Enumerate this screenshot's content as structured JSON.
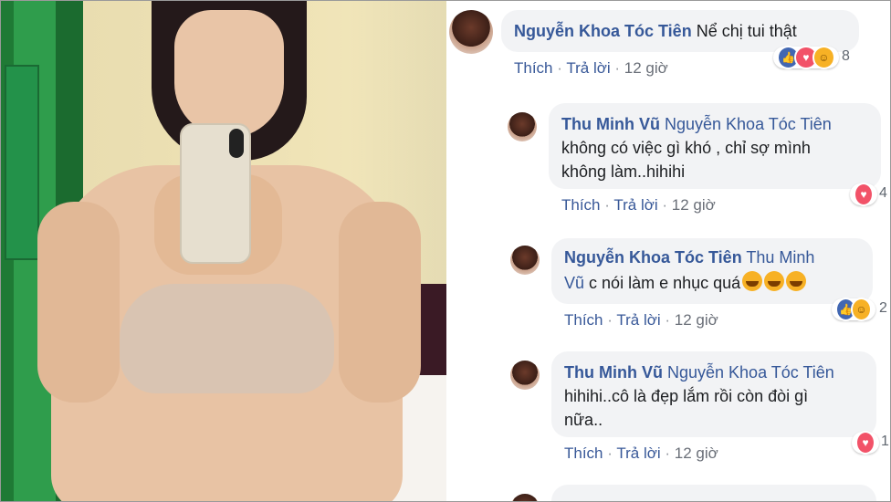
{
  "comments": [
    {
      "author": "Nguyễn Khoa Tóc Tiên",
      "text": "Nể chị tui thật",
      "actions": {
        "like": "Thích",
        "reply": "Trả lời",
        "time": "12 giờ"
      },
      "reactions": {
        "icons": [
          "like-icon",
          "love-icon",
          "haha-icon"
        ],
        "count": "8"
      }
    },
    {
      "author": "Thu Minh Vũ",
      "mention": "Nguyễn Khoa Tóc Tiên",
      "text_line1": "không có việc gì khó , chỉ sợ mình",
      "text_line2": "không làm..hihihi",
      "actions": {
        "like": "Thích",
        "reply": "Trả lời",
        "time": "12 giờ"
      },
      "reactions": {
        "icons": [
          "love-icon"
        ],
        "count": "4"
      }
    },
    {
      "author": "Nguyễn Khoa Tóc Tiên",
      "mention_part1": "Thu Minh",
      "mention_part2": "Vũ",
      "text": "c nói làm e nhục quá",
      "actions": {
        "like": "Thích",
        "reply": "Trả lời",
        "time": "12 giờ"
      },
      "reactions": {
        "icons": [
          "like-icon",
          "haha-icon"
        ],
        "count": "2"
      }
    },
    {
      "author": "Thu Minh Vũ",
      "mention": "Nguyễn Khoa Tóc Tiên",
      "text_line1": "hihihi..cô là đẹp lắm rồi còn đòi gì",
      "text_line2": "nữa..",
      "actions": {
        "like": "Thích",
        "reply": "Trả lời",
        "time": "12 giờ"
      },
      "reactions": {
        "icons": [
          "love-icon"
        ],
        "count": "1"
      }
    }
  ],
  "colors": {
    "link": "#385898",
    "name": "#365899",
    "bubble": "#f2f3f5"
  }
}
